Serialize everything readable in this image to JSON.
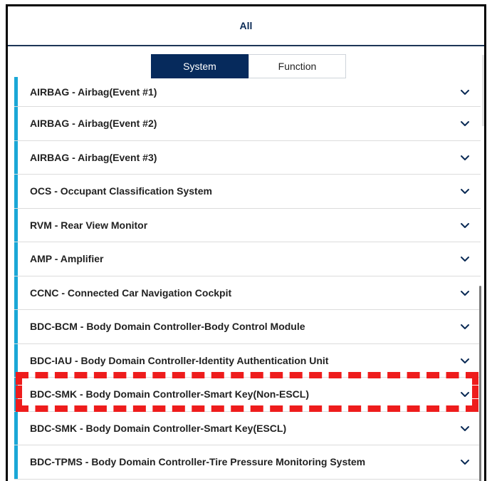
{
  "header": {
    "title": "All"
  },
  "tabs": [
    {
      "label": "System",
      "active": true
    },
    {
      "label": "Function",
      "active": false
    }
  ],
  "list": {
    "items": [
      {
        "label": "AIRBAG - Airbag(Event #1)"
      },
      {
        "label": "AIRBAG - Airbag(Event #2)"
      },
      {
        "label": "AIRBAG - Airbag(Event #3)"
      },
      {
        "label": "OCS - Occupant Classification System"
      },
      {
        "label": "RVM - Rear View Monitor"
      },
      {
        "label": "AMP - Amplifier"
      },
      {
        "label": "CCNC - Connected Car Navigation Cockpit"
      },
      {
        "label": "BDC-BCM - Body Domain Controller-Body Control Module"
      },
      {
        "label": "BDC-IAU - Body Domain Controller-Identity Authentication Unit"
      },
      {
        "label": "BDC-SMK - Body Domain Controller-Smart Key(Non-ESCL)"
      },
      {
        "label": "BDC-SMK - Body Domain Controller-Smart Key(ESCL)"
      },
      {
        "label": "BDC-TPMS - Body Domain Controller-Tire Pressure Monitoring System"
      }
    ],
    "expand_icon": "chevron-down-icon"
  },
  "colors": {
    "accent_bar": "#1aa7d6",
    "tab_active_bg": "#062a5c",
    "header_text": "#0a2a55",
    "highlight": "#ee1c1c"
  }
}
